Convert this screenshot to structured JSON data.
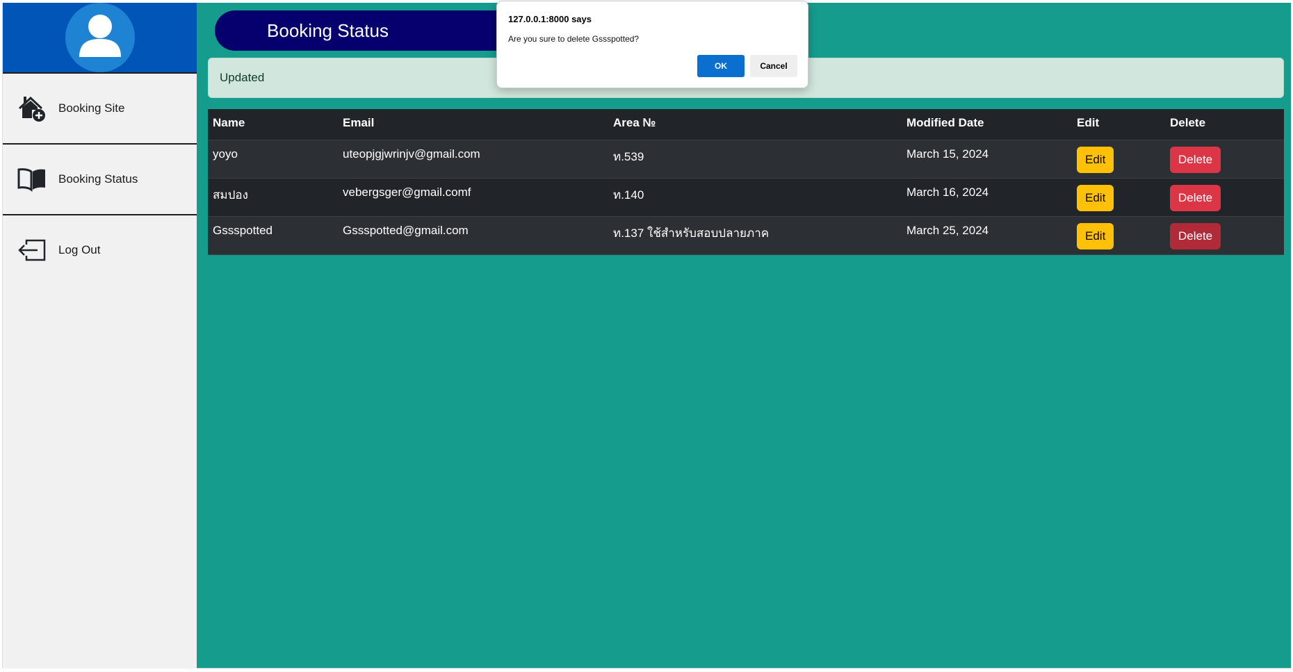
{
  "sidebar": {
    "items": [
      {
        "label": "Booking Site",
        "icon": "house-add-icon"
      },
      {
        "label": "Booking Status",
        "icon": "book-icon"
      },
      {
        "label": "Log Out",
        "icon": "logout-icon"
      }
    ]
  },
  "header": {
    "title": "Booking Status"
  },
  "alert": {
    "text": "Updated"
  },
  "table": {
    "headers": [
      "Name",
      "Email",
      "Area №",
      "Modified Date",
      "Edit",
      "Delete"
    ],
    "rows": [
      {
        "name": "yoyo",
        "email": "uteopjgjwrinjv@gmail.com",
        "area": "ท.539",
        "date": "March 15, 2024",
        "edit": "Edit",
        "delete": "Delete"
      },
      {
        "name": "สมปอง",
        "email": "vebergsger@gmail.comf",
        "area": "ท.140",
        "date": "March 16, 2024",
        "edit": "Edit",
        "delete": "Delete"
      },
      {
        "name": "Gssspotted",
        "email": "Gssspotted@gmail.com",
        "area": "ท.137 ใช้สำหรับสอบปลายภาค",
        "date": "March 25, 2024",
        "edit": "Edit",
        "delete": "Delete"
      }
    ]
  },
  "dialog": {
    "title": "127.0.0.1:8000 says",
    "message": "Are you sure to delete Gssspotted?",
    "ok": "OK",
    "cancel": "Cancel"
  },
  "colors": {
    "background": "#159c8c",
    "sidebar_top": "#0055b7",
    "header_pill": "#06006e",
    "edit_button": "#ffc107",
    "delete_button": "#dc3545",
    "dialog_ok": "#0a6fcf"
  }
}
